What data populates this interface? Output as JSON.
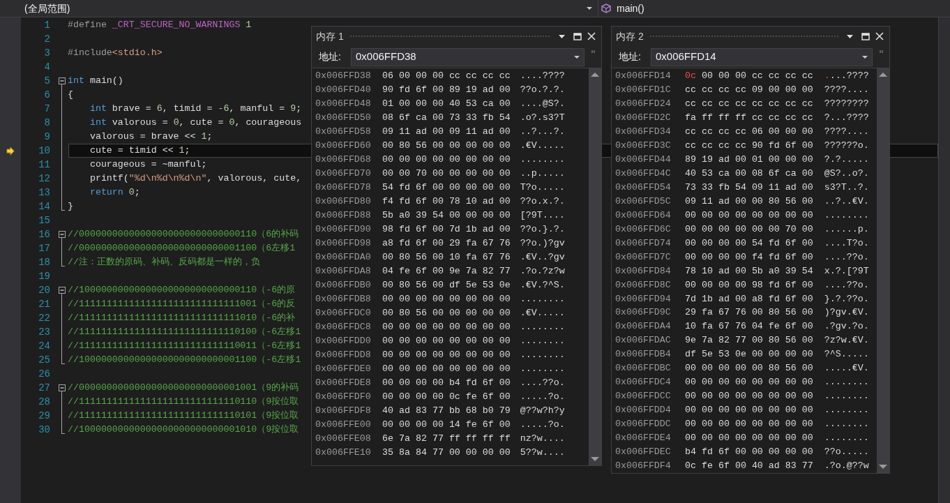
{
  "navigation_bar": {
    "scope": "(全局范围)",
    "member": "main()"
  },
  "editor": {
    "lines": [
      {
        "number": "1",
        "tokens": [
          {
            "kind": "preproc",
            "text": "#define"
          },
          {
            "kind": "macro",
            "text": " _CRT_SECURE_NO_WARNINGS"
          },
          {
            "kind": "number",
            "text": " 1"
          }
        ],
        "current": false
      },
      {
        "number": "2",
        "current": false
      },
      {
        "number": "3",
        "tokens": [
          {
            "kind": "preproc",
            "text": "#include"
          },
          {
            "kind": "string",
            "text": "<stdio.h>"
          }
        ],
        "current": false
      },
      {
        "number": "4",
        "current": false
      },
      {
        "number": "5",
        "tokens": [
          {
            "kind": "keyword",
            "text": "int"
          },
          {
            "kind": "plain",
            "text": " main()"
          }
        ],
        "current": false,
        "expanded": true,
        "children": [
          {
            "number": "6",
            "tokens": [
              {
                "kind": "plain",
                "text": "{"
              }
            ],
            "current": false
          },
          {
            "number": "7",
            "tokens": [
              {
                "kind": "keyword",
                "text": "    int"
              },
              {
                "kind": "plain",
                "text": " brave = "
              },
              {
                "kind": "number",
                "text": "6"
              },
              {
                "kind": "plain",
                "text": ", timid = "
              },
              {
                "kind": "number",
                "text": "-6"
              },
              {
                "kind": "plain",
                "text": ", manful = "
              },
              {
                "kind": "number",
                "text": "9"
              },
              {
                "kind": "plain",
                "text": ";"
              }
            ],
            "current": false
          },
          {
            "number": "8",
            "tokens": [
              {
                "kind": "keyword",
                "text": "    int"
              },
              {
                "kind": "plain",
                "text": " valorous = "
              },
              {
                "kind": "number",
                "text": "0"
              },
              {
                "kind": "plain",
                "text": ", cute = "
              },
              {
                "kind": "number",
                "text": "0"
              },
              {
                "kind": "plain",
                "text": ", courageous"
              }
            ],
            "current": false
          },
          {
            "number": "9",
            "tokens": [
              {
                "kind": "plain",
                "text": "    valorous = brave << "
              },
              {
                "kind": "number",
                "text": "1"
              },
              {
                "kind": "plain",
                "text": ";"
              }
            ],
            "current": false
          },
          {
            "number": "10",
            "tokens": [
              {
                "kind": "plain",
                "text": "    cute = timid << "
              },
              {
                "kind": "number",
                "text": "1"
              },
              {
                "kind": "plain",
                "text": ";"
              }
            ],
            "current": true
          },
          {
            "number": "11",
            "tokens": [
              {
                "kind": "plain",
                "text": "    courageous = ~manful;"
              }
            ],
            "current": false
          },
          {
            "number": "12",
            "tokens": [
              {
                "kind": "plain",
                "text": "    printf("
              },
              {
                "kind": "string",
                "text": "\"%d\\n%d\\n%d\\n\""
              },
              {
                "kind": "plain",
                "text": ", valorous, cute,"
              }
            ],
            "current": false
          },
          {
            "number": "13",
            "tokens": [
              {
                "kind": "keyword",
                "text": "    return"
              },
              {
                "kind": "number",
                "text": " 0"
              },
              {
                "kind": "plain",
                "text": ";"
              }
            ],
            "current": false
          },
          {
            "number": "14",
            "tokens": [
              {
                "kind": "plain",
                "text": "}"
              }
            ],
            "current": false
          }
        ]
      },
      {
        "number": "15",
        "current": false
      },
      {
        "number": "16",
        "tokens": [
          {
            "kind": "comment",
            "text": "//00000000000000000000000000000110（6的补码"
          }
        ],
        "current": false,
        "expanded": true,
        "children": [
          {
            "number": "17",
            "tokens": [
              {
                "kind": "comment",
                "text": "//00000000000000000000000000001100（6左移1"
              }
            ],
            "current": false
          },
          {
            "number": "18",
            "tokens": [
              {
                "kind": "comment",
                "text": "//注：正数的原码、补码、反码都是一样的，负"
              }
            ],
            "current": false
          }
        ]
      },
      {
        "number": "19",
        "current": false
      },
      {
        "number": "20",
        "tokens": [
          {
            "kind": "comment",
            "text": "//10000000000000000000000000000110（-6的原"
          }
        ],
        "current": false,
        "expanded": true,
        "children": [
          {
            "number": "21",
            "tokens": [
              {
                "kind": "comment",
                "text": "//11111111111111111111111111111001（-6的反"
              }
            ],
            "current": false
          },
          {
            "number": "22",
            "tokens": [
              {
                "kind": "comment",
                "text": "//11111111111111111111111111111010（-6的补"
              }
            ],
            "current": false
          },
          {
            "number": "23",
            "tokens": [
              {
                "kind": "comment",
                "text": "//11111111111111111111111111110100（-6左移1"
              }
            ],
            "current": false
          },
          {
            "number": "24",
            "tokens": [
              {
                "kind": "comment",
                "text": "//11111111111111111111111111110011（-6左移1"
              }
            ],
            "current": false
          },
          {
            "number": "25",
            "tokens": [
              {
                "kind": "comment",
                "text": "//10000000000000000000000000001100（-6左移1"
              }
            ],
            "current": false
          }
        ]
      },
      {
        "number": "26",
        "current": false
      },
      {
        "number": "27",
        "tokens": [
          {
            "kind": "comment",
            "text": "//00000000000000000000000000001001（9的补码"
          }
        ],
        "current": false,
        "expanded": true,
        "children": [
          {
            "number": "28",
            "tokens": [
              {
                "kind": "comment",
                "text": "//11111111111111111111111111110110（9按位取"
              }
            ],
            "current": false
          },
          {
            "number": "29",
            "tokens": [
              {
                "kind": "comment",
                "text": "//11111111111111111111111111110101（9按位取"
              }
            ],
            "current": false
          },
          {
            "number": "30",
            "tokens": [
              {
                "kind": "comment",
                "text": "//10000000000000000000000000001010（9按位取"
              }
            ],
            "current": false
          }
        ]
      }
    ]
  },
  "memory_windows": [
    {
      "title": "内存 1",
      "address_label": "地址:",
      "address": "0x006FFD38",
      "rows": [
        {
          "address": "0x006FFD38",
          "bytes": "06 00 00 00 cc cc cc cc",
          "ascii": "....????",
          "changed": [
            false,
            false,
            false,
            false,
            false,
            false,
            false,
            false
          ]
        },
        {
          "address": "0x006FFD40",
          "bytes": "90 fd 6f 00 89 19 ad 00",
          "ascii": "??o.?.?.",
          "changed": [
            false,
            false,
            false,
            false,
            false,
            false,
            false,
            false
          ]
        },
        {
          "address": "0x006FFD48",
          "bytes": "01 00 00 00 40 53 ca 00",
          "ascii": "....@S?.",
          "changed": [
            false,
            false,
            false,
            false,
            false,
            false,
            false,
            false
          ]
        },
        {
          "address": "0x006FFD50",
          "bytes": "08 6f ca 00 73 33 fb 54",
          "ascii": ".o?.s3?T",
          "changed": [
            false,
            false,
            false,
            false,
            false,
            false,
            false,
            false
          ]
        },
        {
          "address": "0x006FFD58",
          "bytes": "09 11 ad 00 09 11 ad 00",
          "ascii": "..?...?.",
          "changed": [
            false,
            false,
            false,
            false,
            false,
            false,
            false,
            false
          ]
        },
        {
          "address": "0x006FFD60",
          "bytes": "00 80 56 00 00 00 00 00",
          "ascii": ".€V.....",
          "changed": [
            false,
            false,
            false,
            false,
            false,
            false,
            false,
            false
          ]
        },
        {
          "address": "0x006FFD68",
          "bytes": "00 00 00 00 00 00 00 00",
          "ascii": "........",
          "changed": [
            false,
            false,
            false,
            false,
            false,
            false,
            false,
            false
          ]
        },
        {
          "address": "0x006FFD70",
          "bytes": "00 00 70 00 00 00 00 00",
          "ascii": "..p.....",
          "changed": [
            false,
            false,
            false,
            false,
            false,
            false,
            false,
            false
          ]
        },
        {
          "address": "0x006FFD78",
          "bytes": "54 fd 6f 00 00 00 00 00",
          "ascii": "T?o.....",
          "changed": [
            false,
            false,
            false,
            false,
            false,
            false,
            false,
            false
          ]
        },
        {
          "address": "0x006FFD80",
          "bytes": "f4 fd 6f 00 78 10 ad 00",
          "ascii": "??o.x.?.",
          "changed": [
            false,
            false,
            false,
            false,
            false,
            false,
            false,
            false
          ]
        },
        {
          "address": "0x006FFD88",
          "bytes": "5b a0 39 54 00 00 00 00",
          "ascii": "[?9T....",
          "changed": [
            false,
            false,
            false,
            false,
            false,
            false,
            false,
            false
          ]
        },
        {
          "address": "0x006FFD90",
          "bytes": "98 fd 6f 00 7d 1b ad 00",
          "ascii": "??o.}.?.",
          "changed": [
            false,
            false,
            false,
            false,
            false,
            false,
            false,
            false
          ]
        },
        {
          "address": "0x006FFD98",
          "bytes": "a8 fd 6f 00 29 fa 67 76",
          "ascii": "??o.)?gv",
          "changed": [
            false,
            false,
            false,
            false,
            false,
            false,
            false,
            false
          ]
        },
        {
          "address": "0x006FFDA0",
          "bytes": "00 80 56 00 10 fa 67 76",
          "ascii": ".€V..?gv",
          "changed": [
            false,
            false,
            false,
            false,
            false,
            false,
            false,
            false
          ]
        },
        {
          "address": "0x006FFDA8",
          "bytes": "04 fe 6f 00 9e 7a 82 77",
          "ascii": ".?o.?z?w",
          "changed": [
            false,
            false,
            false,
            false,
            false,
            false,
            false,
            false
          ]
        },
        {
          "address": "0x006FFDB0",
          "bytes": "00 80 56 00 df 5e 53 0e",
          "ascii": ".€V.?^S.",
          "changed": [
            false,
            false,
            false,
            false,
            false,
            false,
            false,
            false
          ]
        },
        {
          "address": "0x006FFDB8",
          "bytes": "00 00 00 00 00 00 00 00",
          "ascii": "........",
          "changed": [
            false,
            false,
            false,
            false,
            false,
            false,
            false,
            false
          ]
        },
        {
          "address": "0x006FFDC0",
          "bytes": "00 80 56 00 00 00 00 00",
          "ascii": ".€V.....",
          "changed": [
            false,
            false,
            false,
            false,
            false,
            false,
            false,
            false
          ]
        },
        {
          "address": "0x006FFDC8",
          "bytes": "00 00 00 00 00 00 00 00",
          "ascii": "........",
          "changed": [
            false,
            false,
            false,
            false,
            false,
            false,
            false,
            false
          ]
        },
        {
          "address": "0x006FFDD0",
          "bytes": "00 00 00 00 00 00 00 00",
          "ascii": "........",
          "changed": [
            false,
            false,
            false,
            false,
            false,
            false,
            false,
            false
          ]
        },
        {
          "address": "0x006FFDD8",
          "bytes": "00 00 00 00 00 00 00 00",
          "ascii": "........",
          "changed": [
            false,
            false,
            false,
            false,
            false,
            false,
            false,
            false
          ]
        },
        {
          "address": "0x006FFDE0",
          "bytes": "00 00 00 00 00 00 00 00",
          "ascii": "........",
          "changed": [
            false,
            false,
            false,
            false,
            false,
            false,
            false,
            false
          ]
        },
        {
          "address": "0x006FFDE8",
          "bytes": "00 00 00 00 b4 fd 6f 00",
          "ascii": "....??o.",
          "changed": [
            false,
            false,
            false,
            false,
            false,
            false,
            false,
            false
          ]
        },
        {
          "address": "0x006FFDF0",
          "bytes": "00 00 00 00 0c fe 6f 00",
          "ascii": ".....?o.",
          "changed": [
            false,
            false,
            false,
            false,
            false,
            false,
            false,
            false
          ]
        },
        {
          "address": "0x006FFDF8",
          "bytes": "40 ad 83 77 bb 68 b0 79",
          "ascii": "@??w?h?y",
          "changed": [
            false,
            false,
            false,
            false,
            false,
            false,
            false,
            false
          ]
        },
        {
          "address": "0x006FFE00",
          "bytes": "00 00 00 00 14 fe 6f 00",
          "ascii": ".....?o.",
          "changed": [
            false,
            false,
            false,
            false,
            false,
            false,
            false,
            false
          ]
        },
        {
          "address": "0x006FFE08",
          "bytes": "6e 7a 82 77 ff ff ff ff",
          "ascii": "nz?w....",
          "changed": [
            false,
            false,
            false,
            false,
            false,
            false,
            false,
            false
          ]
        },
        {
          "address": "0x006FFE10",
          "bytes": "35 8a 84 77 00 00 00 00",
          "ascii": "5??w....",
          "changed": [
            false,
            false,
            false,
            false,
            false,
            false,
            false,
            false
          ]
        }
      ]
    },
    {
      "title": "内存 2",
      "address_label": "地址:",
      "address": "0x006FFD14",
      "rows": [
        {
          "address": "0x006FFD14",
          "bytes": "0c 00 00 00 cc cc cc cc",
          "ascii": "....????",
          "changed": [
            true,
            false,
            false,
            false,
            false,
            false,
            false,
            false
          ]
        },
        {
          "address": "0x006FFD1C",
          "bytes": "cc cc cc cc 09 00 00 00",
          "ascii": "????....",
          "changed": [
            false,
            false,
            false,
            false,
            false,
            false,
            false,
            false
          ]
        },
        {
          "address": "0x006FFD24",
          "bytes": "cc cc cc cc cc cc cc cc",
          "ascii": "????????",
          "changed": [
            false,
            false,
            false,
            false,
            false,
            false,
            false,
            false
          ]
        },
        {
          "address": "0x006FFD2C",
          "bytes": "fa ff ff ff cc cc cc cc",
          "ascii": "?...????",
          "changed": [
            false,
            false,
            false,
            false,
            false,
            false,
            false,
            false
          ]
        },
        {
          "address": "0x006FFD34",
          "bytes": "cc cc cc cc 06 00 00 00",
          "ascii": "????....",
          "changed": [
            false,
            false,
            false,
            false,
            false,
            false,
            false,
            false
          ]
        },
        {
          "address": "0x006FFD3C",
          "bytes": "cc cc cc cc 90 fd 6f 00",
          "ascii": "??????o.",
          "changed": [
            false,
            false,
            false,
            false,
            false,
            false,
            false,
            false
          ]
        },
        {
          "address": "0x006FFD44",
          "bytes": "89 19 ad 00 01 00 00 00",
          "ascii": "?.?.....",
          "changed": [
            false,
            false,
            false,
            false,
            false,
            false,
            false,
            false
          ]
        },
        {
          "address": "0x006FFD4C",
          "bytes": "40 53 ca 00 08 6f ca 00",
          "ascii": "@S?..o?.",
          "changed": [
            false,
            false,
            false,
            false,
            false,
            false,
            false,
            false
          ]
        },
        {
          "address": "0x006FFD54",
          "bytes": "73 33 fb 54 09 11 ad 00",
          "ascii": "s3?T..?.",
          "changed": [
            false,
            false,
            false,
            false,
            false,
            false,
            false,
            false
          ]
        },
        {
          "address": "0x006FFD5C",
          "bytes": "09 11 ad 00 00 80 56 00",
          "ascii": "..?..€V.",
          "changed": [
            false,
            false,
            false,
            false,
            false,
            false,
            false,
            false
          ]
        },
        {
          "address": "0x006FFD64",
          "bytes": "00 00 00 00 00 00 00 00",
          "ascii": "........",
          "changed": [
            false,
            false,
            false,
            false,
            false,
            false,
            false,
            false
          ]
        },
        {
          "address": "0x006FFD6C",
          "bytes": "00 00 00 00 00 00 70 00",
          "ascii": "......p.",
          "changed": [
            false,
            false,
            false,
            false,
            false,
            false,
            false,
            false
          ]
        },
        {
          "address": "0x006FFD74",
          "bytes": "00 00 00 00 54 fd 6f 00",
          "ascii": "....T?o.",
          "changed": [
            false,
            false,
            false,
            false,
            false,
            false,
            false,
            false
          ]
        },
        {
          "address": "0x006FFD7C",
          "bytes": "00 00 00 00 f4 fd 6f 00",
          "ascii": "....??o.",
          "changed": [
            false,
            false,
            false,
            false,
            false,
            false,
            false,
            false
          ]
        },
        {
          "address": "0x006FFD84",
          "bytes": "78 10 ad 00 5b a0 39 54",
          "ascii": "x.?.[?9T",
          "changed": [
            false,
            false,
            false,
            false,
            false,
            false,
            false,
            false
          ]
        },
        {
          "address": "0x006FFD8C",
          "bytes": "00 00 00 00 98 fd 6f 00",
          "ascii": "....??o.",
          "changed": [
            false,
            false,
            false,
            false,
            false,
            false,
            false,
            false
          ]
        },
        {
          "address": "0x006FFD94",
          "bytes": "7d 1b ad 00 a8 fd 6f 00",
          "ascii": "}.?.??o.",
          "changed": [
            false,
            false,
            false,
            false,
            false,
            false,
            false,
            false
          ]
        },
        {
          "address": "0x006FFD9C",
          "bytes": "29 fa 67 76 00 80 56 00",
          "ascii": ")?gv.€V.",
          "changed": [
            false,
            false,
            false,
            false,
            false,
            false,
            false,
            false
          ]
        },
        {
          "address": "0x006FFDA4",
          "bytes": "10 fa 67 76 04 fe 6f 00",
          "ascii": ".?gv.?o.",
          "changed": [
            false,
            false,
            false,
            false,
            false,
            false,
            false,
            false
          ]
        },
        {
          "address": "0x006FFDAC",
          "bytes": "9e 7a 82 77 00 80 56 00",
          "ascii": "?z?w.€V.",
          "changed": [
            false,
            false,
            false,
            false,
            false,
            false,
            false,
            false
          ]
        },
        {
          "address": "0x006FFDB4",
          "bytes": "df 5e 53 0e 00 00 00 00",
          "ascii": "?^S.....",
          "changed": [
            false,
            false,
            false,
            false,
            false,
            false,
            false,
            false
          ]
        },
        {
          "address": "0x006FFDBC",
          "bytes": "00 00 00 00 00 80 56 00",
          "ascii": ".....€V.",
          "changed": [
            false,
            false,
            false,
            false,
            false,
            false,
            false,
            false
          ]
        },
        {
          "address": "0x006FFDC4",
          "bytes": "00 00 00 00 00 00 00 00",
          "ascii": "........",
          "changed": [
            false,
            false,
            false,
            false,
            false,
            false,
            false,
            false
          ]
        },
        {
          "address": "0x006FFDCC",
          "bytes": "00 00 00 00 00 00 00 00",
          "ascii": "........",
          "changed": [
            false,
            false,
            false,
            false,
            false,
            false,
            false,
            false
          ]
        },
        {
          "address": "0x006FFDD4",
          "bytes": "00 00 00 00 00 00 00 00",
          "ascii": "........",
          "changed": [
            false,
            false,
            false,
            false,
            false,
            false,
            false,
            false
          ]
        },
        {
          "address": "0x006FFDDC",
          "bytes": "00 00 00 00 00 00 00 00",
          "ascii": "........",
          "changed": [
            false,
            false,
            false,
            false,
            false,
            false,
            false,
            false
          ]
        },
        {
          "address": "0x006FFDE4",
          "bytes": "00 00 00 00 00 00 00 00",
          "ascii": "........",
          "changed": [
            false,
            false,
            false,
            false,
            false,
            false,
            false,
            false
          ]
        },
        {
          "address": "0x006FFDEC",
          "bytes": "b4 fd 6f 00 00 00 00 00",
          "ascii": "??o.....",
          "changed": [
            false,
            false,
            false,
            false,
            false,
            false,
            false,
            false
          ]
        },
        {
          "address": "0x006FFDF4",
          "bytes": "0c fe 6f 00 40 ad 83 77",
          "ascii": ".?o.@??w",
          "changed": [
            false,
            false,
            false,
            false,
            false,
            false,
            false,
            false
          ]
        }
      ]
    }
  ]
}
